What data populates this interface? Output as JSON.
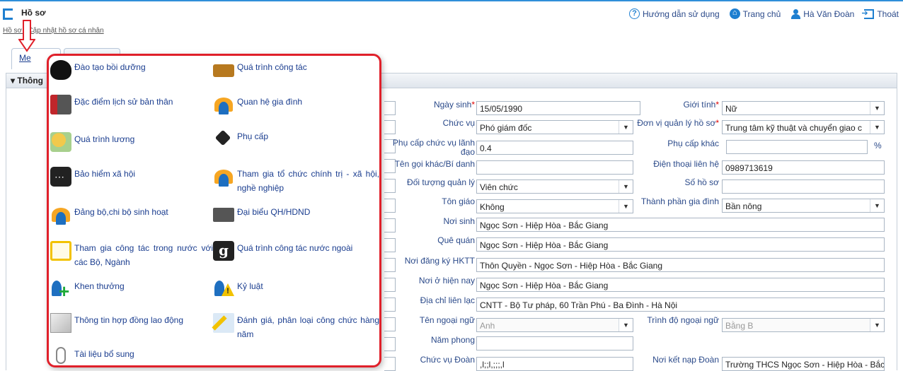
{
  "header": {
    "title": "Hồ sơ",
    "nav": {
      "help": "Hướng dẫn sử dụng",
      "home": "Trang chủ",
      "user": "Hà Văn Đoàn",
      "logout": "Thoát"
    },
    "breadcrumb": "Hồ sơ / Cập nhật hồ sơ cá nhân"
  },
  "tabs": {
    "first": "Me"
  },
  "section": {
    "title": "▾ Thông"
  },
  "form": {
    "ngay_sinh": {
      "label": "Ngày sinh",
      "value": "15/05/1990"
    },
    "gioi_tinh": {
      "label": "Giới tính",
      "value": "Nữ"
    },
    "chuc_vu": {
      "label": "Chức vụ",
      "value": "Phó giám đốc"
    },
    "don_vi": {
      "label": "Đơn vị quản lý hồ sơ",
      "value": "Trung tâm kỹ thuật và chuyển giao c"
    },
    "phu_cap_cv": {
      "label": "Phụ cấp chức vụ lãnh đạo",
      "value": "0.4"
    },
    "phu_cap_khac": {
      "label": "Phụ cấp khác",
      "value": "",
      "unit": "%"
    },
    "ten_goi_khac": {
      "label": "Tên gọi khác/Bí danh",
      "value": ""
    },
    "dien_thoai": {
      "label": "Điện thoại liên hệ",
      "value": "0989713619"
    },
    "doi_tuong": {
      "label": "Đối tượng quản lý",
      "value": "Viên chức"
    },
    "so_ho_so": {
      "label": "Số hồ sơ",
      "value": ""
    },
    "ton_giao": {
      "label": "Tôn giáo",
      "value": "Không"
    },
    "thanh_phan": {
      "label": "Thành phần gia đình",
      "value": "Bần nông"
    },
    "noi_sinh": {
      "label": "Nơi sinh",
      "value": "Ngọc Sơn - Hiệp Hòa - Bắc Giang"
    },
    "que_quan": {
      "label": "Quê quán",
      "value": "Ngọc Sơn - Hiệp Hòa - Bắc Giang"
    },
    "hktt": {
      "label": "Nơi đăng ký HKTT",
      "value": "Thôn Quyền - Ngọc Sơn - Hiệp Hòa - Bắc Giang"
    },
    "noi_o": {
      "label": "Nơi ở hiện nay",
      "value": "Ngọc Sơn - Hiệp Hòa - Bắc Giang"
    },
    "dia_chi": {
      "label": "Địa chỉ liên lạc",
      "value": "CNTT - Bộ Tư pháp, 60 Trần Phú - Ba Đình - Hà Nội"
    },
    "ngoai_ngu": {
      "label": "Tên ngoại ngữ",
      "value": "Anh"
    },
    "trinh_do": {
      "label": "Trình độ ngoại ngữ",
      "value": "Bằng B"
    },
    "nam_phong": {
      "label": "Năm phong",
      "value": ""
    },
    "chuc_vu_doan": {
      "label": "Chức vụ Đoàn",
      "value": ",l;;l,;;;,l"
    },
    "noi_ket_nap": {
      "label": "Nơi kết nạp Đoàn",
      "value": "Trường THCS Ngọc Sơn - Hiệp Hòa - Bắc G"
    }
  },
  "menu": {
    "dao_tao": "Đào tạo bồi dưỡng",
    "qua_trinh_cong_tac": "Quá trình công tác",
    "dac_diem": "Đặc điểm lịch sử bản thân",
    "quan_he": "Quan hệ gia đình",
    "luong": "Quá trình lương",
    "phu_cap": "Phụ cấp",
    "bhxh": "Bảo hiểm xã hội",
    "to_chuc": "Tham gia tổ chức chính trị - xã hội, nghề nghiệp",
    "dang_bo": "Đảng bộ,chi bộ sinh hoạt",
    "dai_bieu": "Đại biểu QH/HDND",
    "trong_nuoc": "Tham gia công tác trong nước với các Bộ, Ngành",
    "nuoc_ngoai": "Quá trình công tác nước ngoài",
    "khen": "Khen thưởng",
    "ky_luat": "Kỷ luật",
    "hop_dong": "Thông tin hợp đồng lao động",
    "danh_gia": "Đánh giá, phân loại công chức hàng năm",
    "bo_sung": "Tài liệu bổ sung"
  },
  "colors": {
    "accent": "#1e7fd0",
    "highlight": "#e0202a"
  }
}
